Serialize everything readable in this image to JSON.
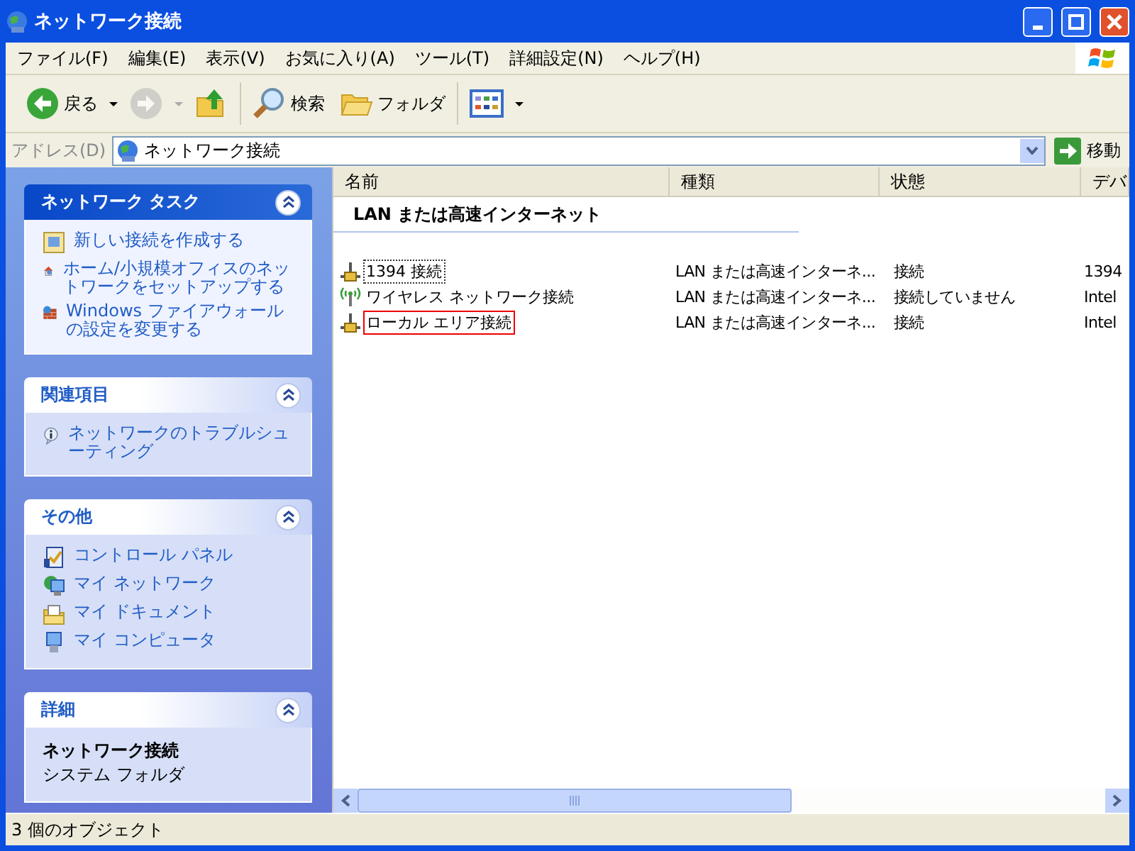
{
  "window": {
    "title": "ネットワーク接続"
  },
  "menu": [
    "ファイル(F)",
    "編集(E)",
    "表示(V)",
    "お気に入り(A)",
    "ツール(T)",
    "詳細設定(N)",
    "ヘルプ(H)"
  ],
  "toolbar_groups": [
    {
      "buttons": [
        {
          "kind": "back",
          "label": "戻る",
          "disabled": false
        },
        {
          "kind": "forward",
          "disabled": true
        },
        {
          "kind": "up",
          "disabled": false
        }
      ]
    },
    {
      "buttons": [
        {
          "kind": "search",
          "label": "検索",
          "disabled": false
        },
        {
          "kind": "folders",
          "label": "フォルダ",
          "disabled": false
        }
      ]
    },
    {
      "buttons": [
        {
          "kind": "views",
          "disabled": false
        }
      ]
    }
  ],
  "address": {
    "label": "アドレス(D)",
    "value": "ネットワーク接続",
    "go": "移動"
  },
  "task_panes": [
    {
      "title": "ネットワーク タスク",
      "kind": "special",
      "expanded": true,
      "items": [
        "新しい接続を作成する",
        "ホーム/小規模オフィスのネットワークをセットアップする",
        "Windows ファイアウォールの設定を変更する"
      ]
    },
    {
      "title": "関連項目",
      "kind": "links",
      "expanded": true,
      "items": [
        "ネットワークのトラブルシューティング"
      ]
    },
    {
      "title": "その他",
      "kind": "links",
      "expanded": true,
      "items": [
        "コントロール パネル",
        "マイ ネットワーク",
        "マイ ドキュメント",
        "マイ コンピュータ"
      ]
    },
    {
      "title": "詳細",
      "kind": "details",
      "expanded": true,
      "name": "ネットワーク接続",
      "description": "システム フォルダ"
    }
  ],
  "list": {
    "columns": [
      "名前",
      "種類",
      "状態",
      "デバ"
    ],
    "group": "LAN または高速インターネット",
    "rows": [
      {
        "kind": "wired",
        "name": "1394 接続",
        "type": "LAN または高速インターネ...",
        "status": "接続",
        "device": "1394",
        "focused": true,
        "outlined": false
      },
      {
        "kind": "wireless",
        "name": "ワイヤレス ネットワーク接続",
        "type": "LAN または高速インターネ...",
        "status": "接続していません",
        "device": "Intel",
        "focused": false,
        "outlined": false
      },
      {
        "kind": "wired",
        "name": "ローカル エリア接続",
        "type": "LAN または高速インターネ...",
        "status": "接続",
        "device": "Intel",
        "focused": false,
        "outlined": true
      }
    ]
  },
  "status_bar": "3 個のオブジェクト"
}
